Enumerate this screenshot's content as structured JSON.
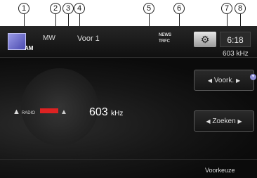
{
  "callouts": [
    "1",
    "2",
    "3",
    "4",
    "5",
    "6",
    "7",
    "8"
  ],
  "topbar": {
    "source_label": "AM",
    "band": "MW",
    "preset": "Voor 1",
    "news_label": "NEWS",
    "trfc_label": "TRFC",
    "clock": "6:18",
    "frequency": "603 kHz"
  },
  "main": {
    "radio_logo": "RADIO",
    "frequency_value": "603",
    "frequency_unit": "kHz"
  },
  "side_buttons": {
    "voork_label": "Voork.",
    "zoeken_label": "Zoeken"
  },
  "bottom": {
    "voorkeuze_label": "Voorkeuze"
  },
  "colors": {
    "source_icon": "#6b6bd6",
    "indicator_red": "#d22222"
  },
  "icons": {
    "settings": "gear-icon",
    "antenna": "antenna-icon",
    "left_arrow": "triangle-left-icon",
    "right_arrow": "triangle-right-icon"
  }
}
